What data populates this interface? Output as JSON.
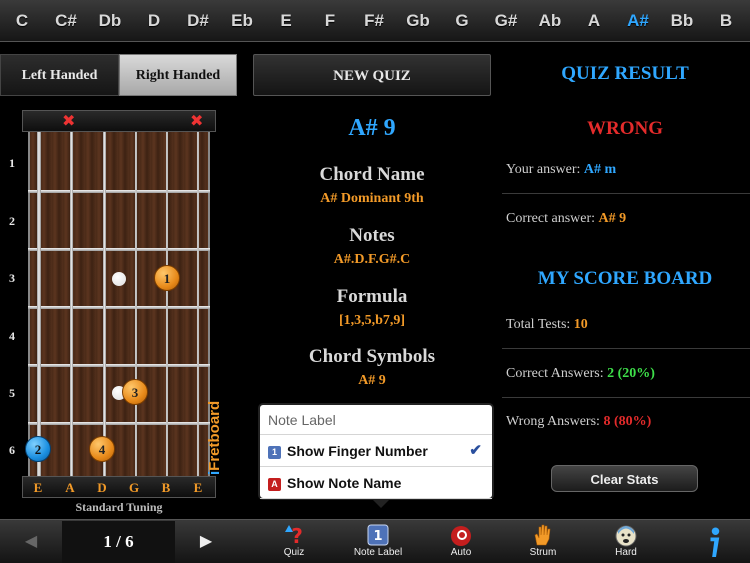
{
  "keys": [
    "C",
    "C#",
    "Db",
    "D",
    "D#",
    "Eb",
    "E",
    "F",
    "F#",
    "Gb",
    "G",
    "G#",
    "Ab",
    "A",
    "A#",
    "Bb",
    "B"
  ],
  "active_key": "A#",
  "colors": {
    "accent_blue": "#2fa7ff",
    "orange": "#f29a28",
    "red": "#e42b2b",
    "green": "#3ee04a"
  },
  "hand": {
    "left_label": "Left Handed",
    "right_label": "Right Handed",
    "selected": "Right Handed"
  },
  "fretboard": {
    "fret_numbers": [
      "1",
      "2",
      "3",
      "4",
      "5",
      "6"
    ],
    "muted_icon": "x-mark-icon",
    "string_labels": [
      "E",
      "A",
      "D",
      "G",
      "B",
      "E"
    ],
    "dots": [
      {
        "finger": "1",
        "string": 5,
        "fret": 3,
        "color": "orange"
      },
      {
        "finger": "3",
        "string": 4,
        "fret": 5,
        "color": "orange"
      },
      {
        "finger": "4",
        "string": 2,
        "fret": 6,
        "color": "orange"
      },
      {
        "finger": "2",
        "string": 1,
        "fret": 6,
        "color": "blue"
      }
    ],
    "tuning": "Standard Tuning",
    "logo": "Fretboard"
  },
  "quiz": {
    "new_quiz_label": "NEW QUIZ",
    "chord_title": "A# 9",
    "chord_name_heading": "Chord Name",
    "chord_name": "A# Dominant 9th",
    "notes_heading": "Notes",
    "notes": "A#.D.F.G#.C",
    "formula_heading": "Formula",
    "formula": "[1,3,5,b7,9]",
    "symbols_heading": "Chord Symbols",
    "symbols": "A# 9"
  },
  "result": {
    "title": "QUIZ RESULT",
    "verdict": "WRONG",
    "your_answer_label": "Your answer:",
    "your_answer": "A# m",
    "correct_answer_label": "Correct answer:",
    "correct_answer": "A# 9",
    "scoreboard_title": "MY SCORE BOARD",
    "total_label": "Total Tests:",
    "total": "10",
    "correct_label": "Correct Answers:",
    "correct": "2 (20%)",
    "wrong_label": "Wrong Answers:",
    "wrong": "8 (80%)",
    "clear_label": "Clear Stats"
  },
  "pager": {
    "label": "1 / 6"
  },
  "toolbar": {
    "quiz": "Quiz",
    "note_label": "Note Label",
    "auto": "Auto",
    "strum": "Strum",
    "hard": "Hard"
  },
  "popover": {
    "title": "Note Label",
    "items": [
      {
        "label": "Show Finger Number",
        "badge": "1",
        "checked": true
      },
      {
        "label": "Show Note Name",
        "badge": "A",
        "checked": false
      }
    ]
  }
}
